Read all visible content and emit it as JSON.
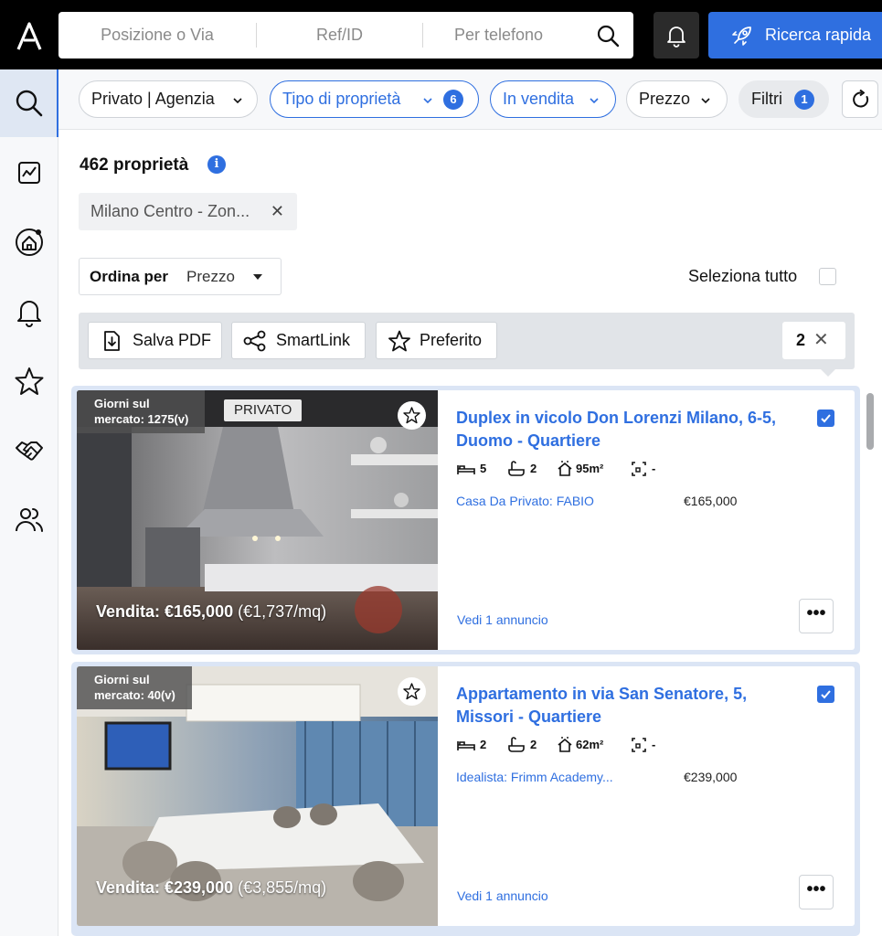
{
  "header": {
    "search_location_placeholder": "Posizione o Via",
    "search_ref_placeholder": "Ref/ID",
    "search_phone_placeholder": "Per telefono",
    "quick_search_label": "Ricerca rapida"
  },
  "filters": {
    "owner_type": "Privato | Agenzia",
    "property_type": "Tipo di proprietà",
    "property_type_count": "6",
    "sale_status": "In vendita",
    "price": "Prezzo",
    "more_filters": "Filtri",
    "more_filters_count": "1"
  },
  "results": {
    "count_label": "462 proprietà",
    "location_tag": "Milano Centro - Zon...",
    "sort_label": "Ordina per",
    "sort_value": "Prezzo",
    "select_all_label": "Seleziona tutto"
  },
  "actions": {
    "save_pdf": "Salva PDF",
    "smartlink": "SmartLink",
    "favorite": "Preferito",
    "selected_count": "2"
  },
  "listings": [
    {
      "days_on_market": "Giorni sul\nmercato: 1275(v)",
      "badge": "PRIVATO",
      "price_overlay_main": "Vendita: €165,000",
      "price_overlay_per_sqm": "(€1,737/mq)",
      "title": "Duplex in vicolo Don Lorenzi Milano, 6-5, Duomo - Quartiere",
      "bedrooms": "5",
      "bathrooms": "2",
      "area": "95m²",
      "plot": "-",
      "agent": "Casa Da Privato: FABIO",
      "price": "€165,000",
      "view_link": "Vedi 1 annuncio",
      "selected": true
    },
    {
      "days_on_market": "Giorni sul\nmercato: 40(v)",
      "badge": "",
      "price_overlay_main": "Vendita: €239,000",
      "price_overlay_per_sqm": "(€3,855/mq)",
      "title": "Appartamento in via San Senatore, 5, Missori - Quartiere",
      "bedrooms": "2",
      "bathrooms": "2",
      "area": "62m²",
      "plot": "-",
      "agent": "Idealista: Frimm Academy...",
      "price": "€239,000",
      "view_link": "Vedi 1 annuncio",
      "selected": true
    }
  ],
  "colors": {
    "accent": "#2f6fe0",
    "topbar": "#000000",
    "sidebar_bg": "#f7f8fa",
    "sidebar_active": "#dfe7f3",
    "selected_card_border": "#dbe5f5"
  },
  "icons": {
    "logo": "app-logo-icon",
    "search": "search-icon",
    "notifications": "bell-icon",
    "quick_search": "rocket-icon",
    "sidebar": [
      "search-icon",
      "chart-icon",
      "home-target-icon",
      "bell-icon",
      "star-icon",
      "handshake-icon",
      "users-icon"
    ]
  }
}
